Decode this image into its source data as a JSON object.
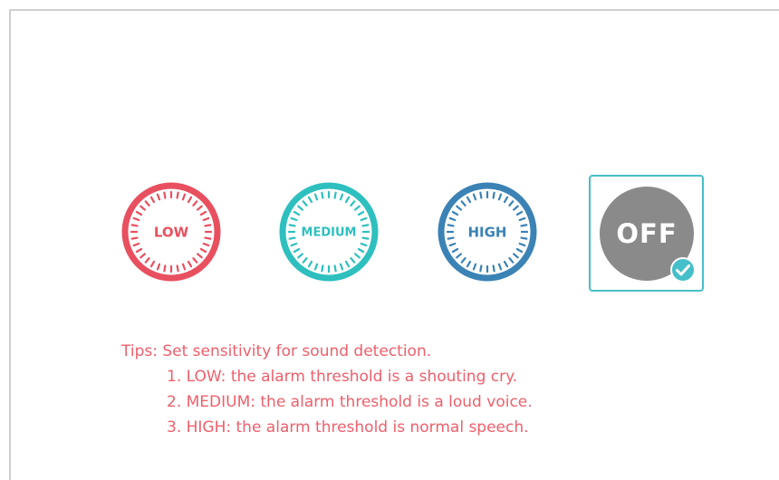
{
  "options": [
    {
      "key": "low",
      "label": "LOW",
      "color": "#e8505f",
      "selected": false
    },
    {
      "key": "medium",
      "label": "MEDIUM",
      "color": "#2ebfbf",
      "selected": false
    },
    {
      "key": "high",
      "label": "HIGH",
      "color": "#3b82b5",
      "selected": false
    },
    {
      "key": "off",
      "label": "OFF",
      "color": "#8a8a8a",
      "selected": true,
      "accent": "#45bfc9",
      "badge_icon": "check-icon"
    }
  ],
  "tips": {
    "heading": "Tips: Set sensitivity for sound detection.",
    "items": [
      "1. LOW: the alarm threshold is a shouting cry.",
      "2. MEDIUM: the alarm threshold is a loud voice.",
      "3. HIGH: the alarm threshold is normal speech."
    ],
    "color": "#ee5f6b"
  }
}
